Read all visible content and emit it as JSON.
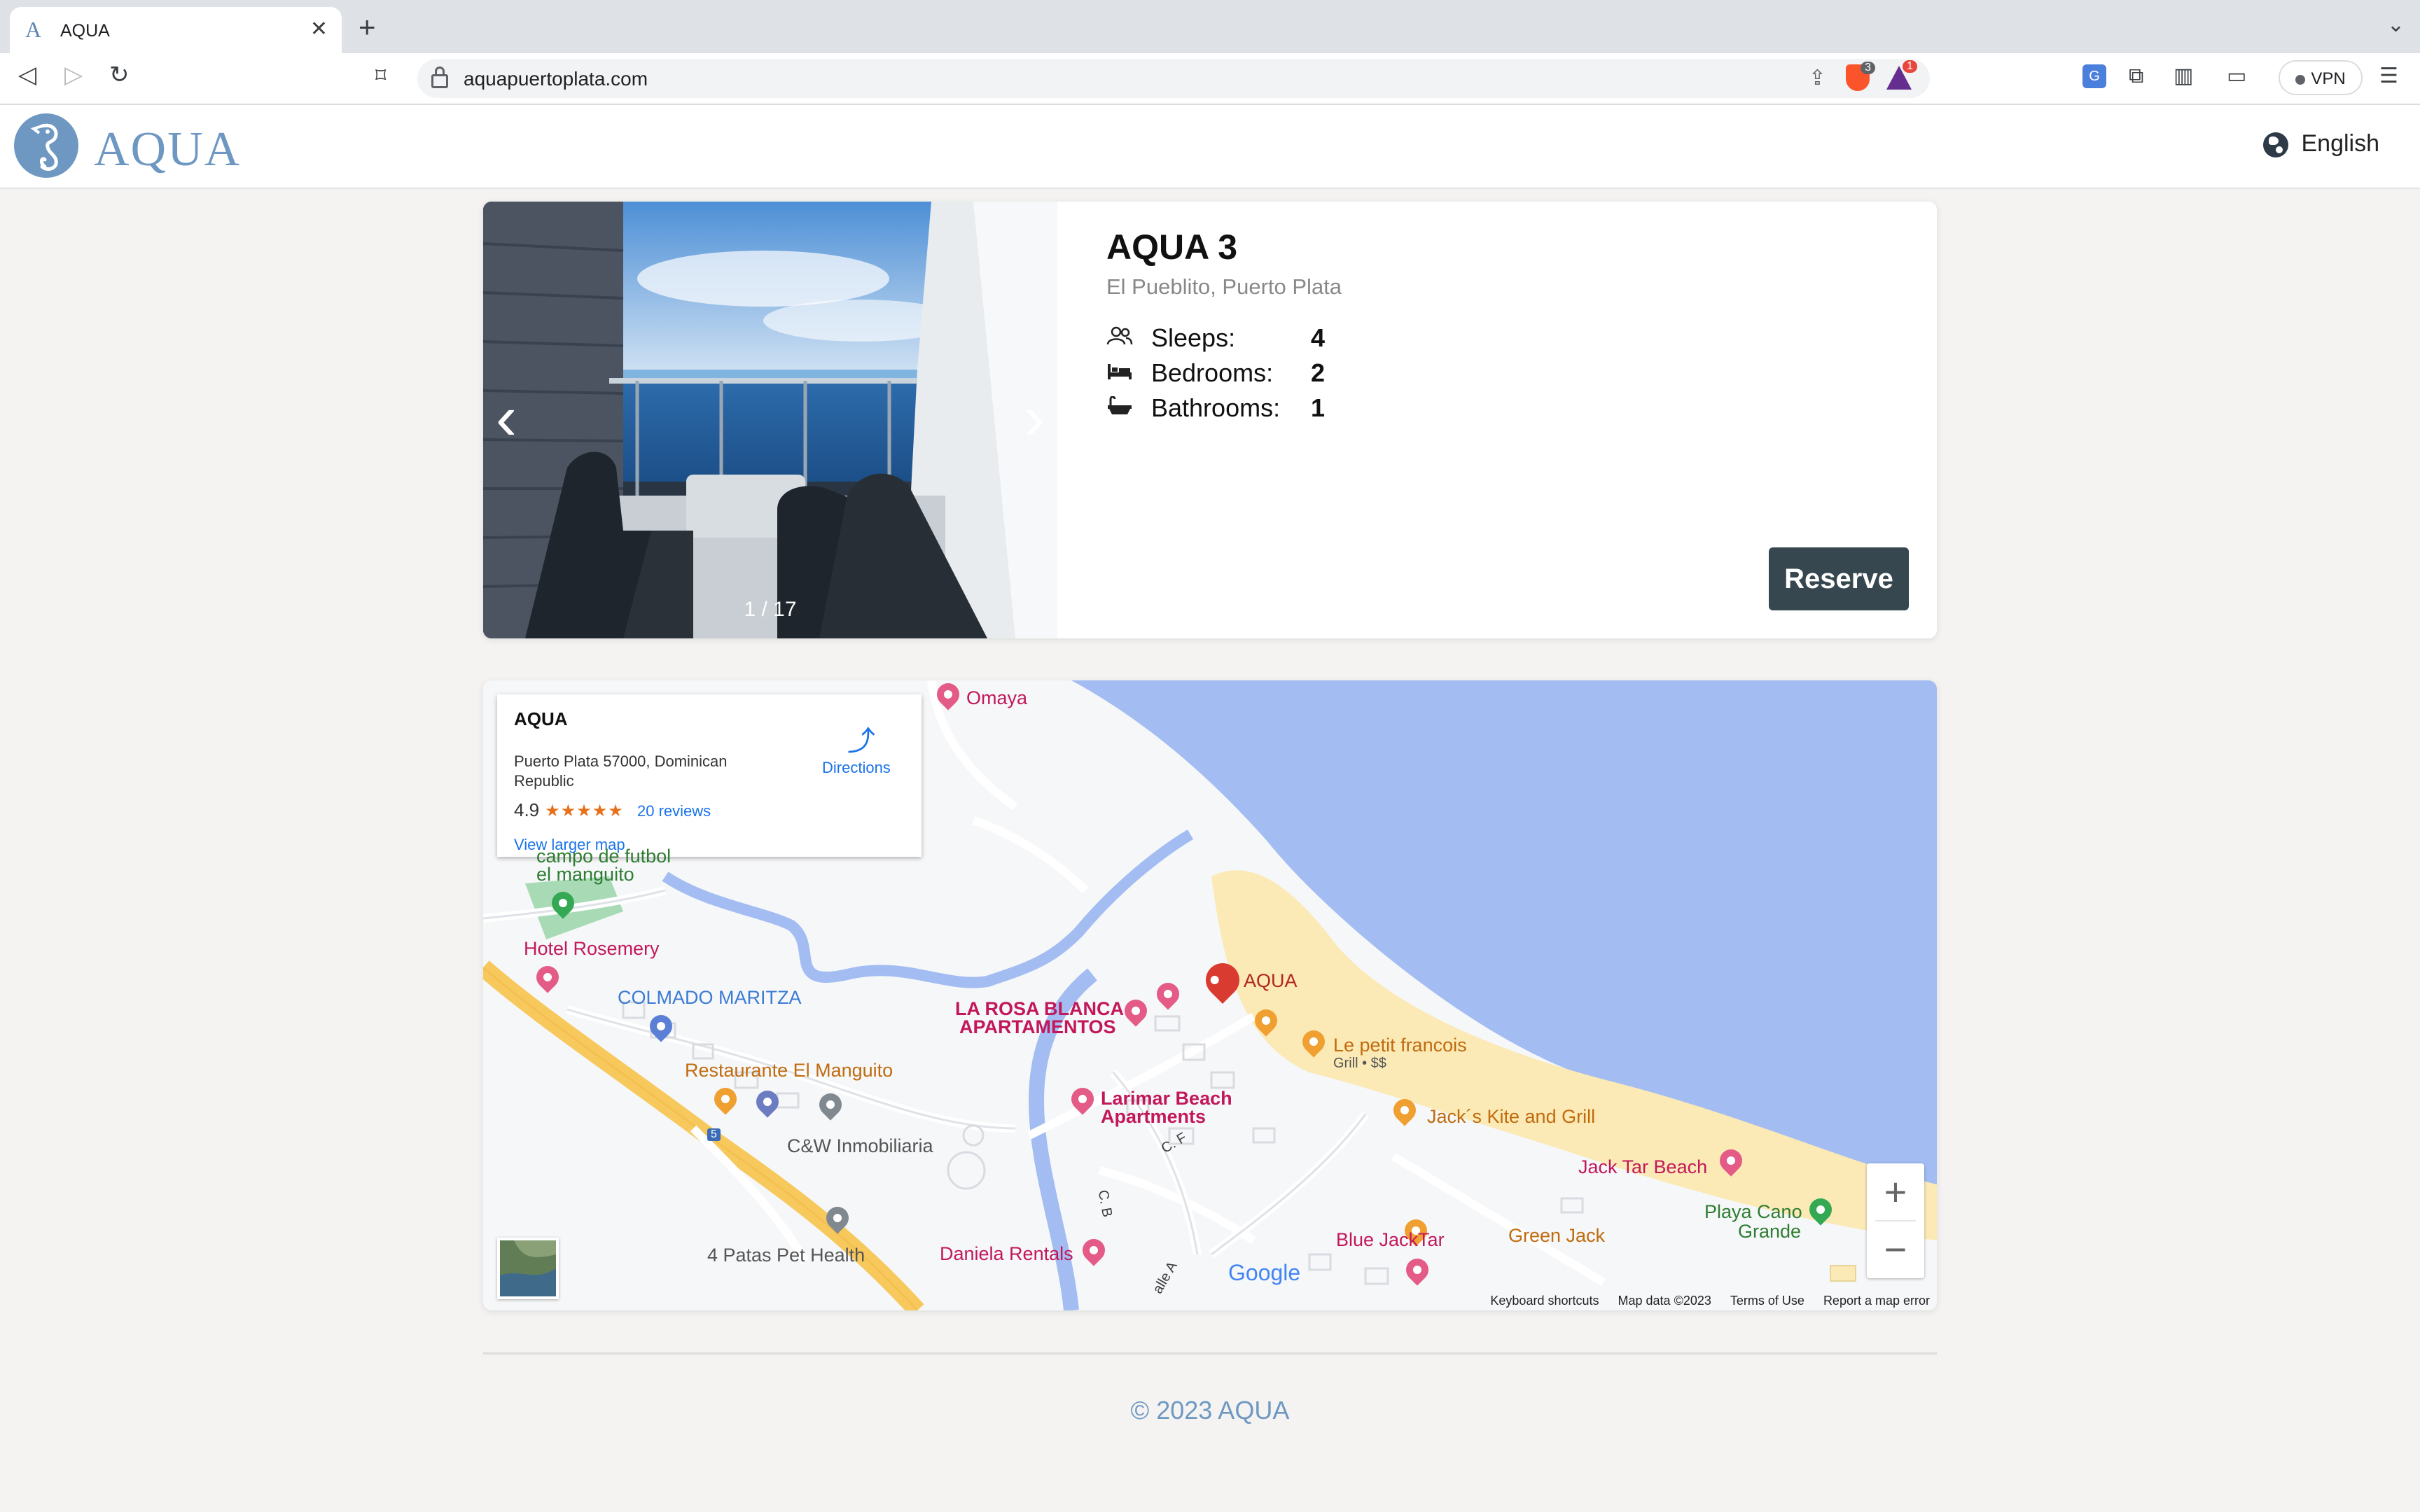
{
  "browser": {
    "tab_title": "AQUA",
    "tab_favicon": "A",
    "url": "aquapuertoplata.com",
    "shields_badge": "3",
    "rewards_badge": "1",
    "vpn_label": "VPN"
  },
  "header": {
    "logo_text": "AQUA",
    "language": "English"
  },
  "listing": {
    "title": "AQUA 3",
    "location": "El Pueblito, Puerto Plata",
    "facts": [
      {
        "label": "Sleeps:",
        "value": "4",
        "icon": "people-icon"
      },
      {
        "label": "Bedrooms:",
        "value": "2",
        "icon": "bed-icon"
      },
      {
        "label": "Bathrooms:",
        "value": "1",
        "icon": "bathtub-icon"
      }
    ],
    "photo_counter": "1 / 17",
    "reserve_label": "Reserve"
  },
  "map": {
    "info": {
      "name": "AQUA",
      "address": "Puerto Plata 57000, Dominican Republic",
      "rating": "4.9",
      "stars": "★★★★★",
      "reviews": "20 reviews",
      "directions": "Directions",
      "larger_map": "View larger map"
    },
    "places": {
      "omaya": "Omaya",
      "campo": "campo de futbol",
      "manguito": "el manguito",
      "rosemery": "Hotel Rosemery",
      "maritza": "COLMADO MARITZA",
      "restaurante": "Restaurante El Manguito",
      "cw": "C&W Inmobiliaria",
      "patas": "4 Patas Pet Health",
      "rosa1": "LA ROSA BLANCA",
      "rosa2": "APARTAMENTOS",
      "aqua": "AQUA",
      "petit": "Le petit francois",
      "petit_sub": "Grill • $$",
      "larimar1": "Larimar Beach",
      "larimar2": "Apartments",
      "jacks": "Jack´s Kite and Grill",
      "jacktar": "Jack Tar Beach",
      "cano1": "Playa Cano",
      "cano2": "Grande",
      "daniela": "Daniela Rentals",
      "bluejack": "Blue JackTar",
      "greenjack": "Green Jack",
      "road_cb": "C. B",
      "road_cf": "C. F",
      "road_calle": "alle A",
      "route5": "5"
    },
    "google": "Google",
    "attribution": {
      "shortcuts": "Keyboard shortcuts",
      "data": "Map data ©2023",
      "terms": "Terms of Use",
      "report": "Report a map error"
    },
    "colors": {
      "water": "#a3bdf3",
      "beach": "#fbe9b6",
      "road": "#f7c95c",
      "pin_red": "#d93b30",
      "pin_pink": "#e35b86"
    }
  },
  "footer": {
    "copyright": "© 2023 AQUA"
  }
}
